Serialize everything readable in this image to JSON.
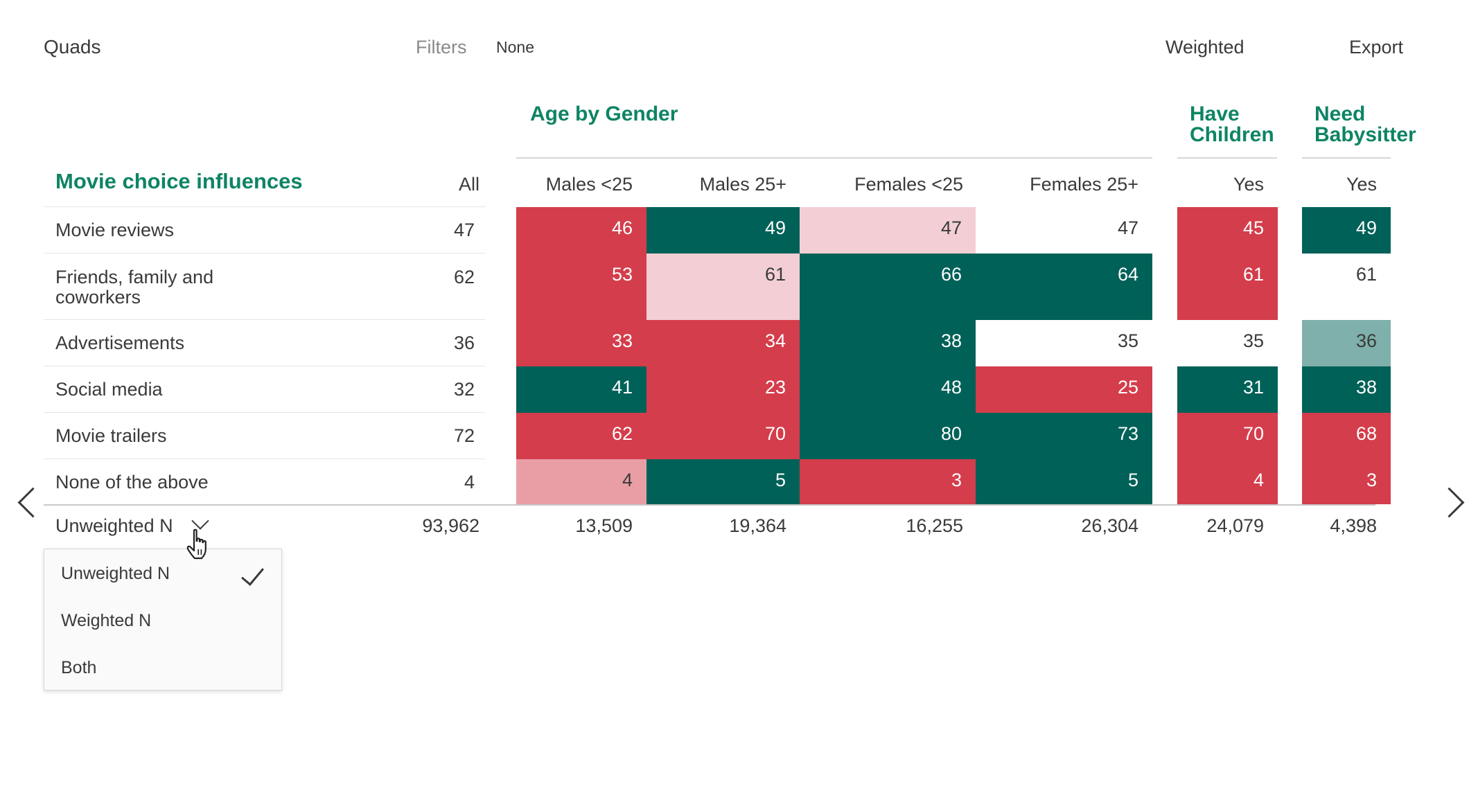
{
  "toolbar": {
    "title": "Quads",
    "filters_label": "Filters",
    "filters_value": "None",
    "weighted_label": "Weighted",
    "export_label": "Export"
  },
  "table": {
    "row_title": "Movie choice influences",
    "groups": [
      {
        "title": "Age by Gender"
      },
      {
        "title": "Have Children"
      },
      {
        "title": "Need Babysitter"
      }
    ],
    "columns": [
      "All",
      "Males <25",
      "Males 25+",
      "Females <25",
      "Females 25+",
      "Yes",
      "Yes"
    ],
    "rows": [
      {
        "label": "Movie reviews",
        "all": "47",
        "cells": [
          "46",
          "49",
          "47",
          "47",
          "45",
          "49"
        ]
      },
      {
        "label": "Friends, family and coworkers",
        "all": "62",
        "cells": [
          "53",
          "61",
          "66",
          "64",
          "61",
          "61"
        ]
      },
      {
        "label": "Advertisements",
        "all": "36",
        "cells": [
          "33",
          "34",
          "38",
          "35",
          "35",
          "36"
        ]
      },
      {
        "label": "Social media",
        "all": "32",
        "cells": [
          "41",
          "23",
          "48",
          "25",
          "31",
          "38"
        ]
      },
      {
        "label": "Movie trailers",
        "all": "72",
        "cells": [
          "62",
          "70",
          "80",
          "73",
          "70",
          "68"
        ]
      },
      {
        "label": "None of the above",
        "all": "4",
        "cells": [
          "4",
          "5",
          "3",
          "5",
          "4",
          "3"
        ]
      }
    ],
    "cell_colors": [
      [
        "red",
        "green",
        "pink",
        "white",
        "red",
        "green"
      ],
      [
        "red",
        "pink",
        "green",
        "green",
        "red",
        "white"
      ],
      [
        "red",
        "red",
        "green",
        "white",
        "white",
        "teal"
      ],
      [
        "green",
        "red",
        "green",
        "red",
        "green",
        "green"
      ],
      [
        "red",
        "red",
        "green",
        "green",
        "red",
        "red"
      ],
      [
        "pinkmid",
        "green",
        "red",
        "green",
        "red",
        "red"
      ]
    ],
    "n_row": {
      "label": "Unweighted N",
      "values": [
        "93,962",
        "13,509",
        "19,364",
        "16,255",
        "26,304",
        "24,079",
        "4,398"
      ]
    }
  },
  "dropdown": {
    "items": [
      "Unweighted N",
      "Weighted N",
      "Both"
    ],
    "selected": "Unweighted N"
  },
  "colors": {
    "accent_green": "#0e8464",
    "cell_red": "#d43d4b",
    "cell_dark_green": "#006158",
    "cell_light_pink": "#f3cfd5",
    "cell_mid_pink": "#e99ea6",
    "cell_teal": "#7fb0ab"
  },
  "icons": {
    "prev": "chevron-left-icon",
    "next": "chevron-right-icon",
    "dropdown": "chevron-down-icon",
    "selected": "check-icon",
    "pointer": "hand-pointer-icon"
  }
}
